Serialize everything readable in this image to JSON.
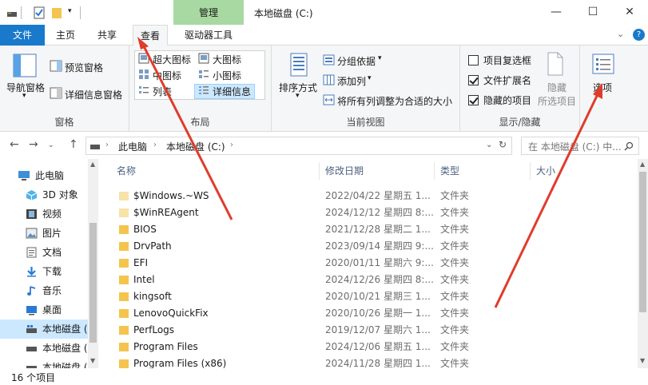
{
  "titlebar": {
    "context_tab": "管理",
    "window_title": "本地磁盘 (C:)",
    "minimize": "—",
    "maximize": "☐",
    "close": "✕"
  },
  "tabs": {
    "file": "文件",
    "home": "主页",
    "share": "共享",
    "view": "查看",
    "drive_tools": "驱动器工具"
  },
  "ribbon": {
    "pane_group": {
      "nav_pane": "导航窗格",
      "preview_pane": "预览窗格",
      "details_pane": "详细信息窗格",
      "label": "窗格"
    },
    "layout_group": {
      "extra_large": "超大图标",
      "large": "大图标",
      "medium": "中图标",
      "small": "小图标",
      "list": "列表",
      "details": "详细信息",
      "label": "布局"
    },
    "current_view_group": {
      "sort_by": "排序方式",
      "group_by": "分组依据",
      "add_columns": "添加列",
      "size_all_columns": "将所有列调整为合适的大小",
      "label": "当前视图"
    },
    "show_hide_group": {
      "item_checkboxes": "项目复选框",
      "file_extensions": "文件扩展名",
      "hidden_items": "隐藏的项目",
      "hide_selected_1": "隐藏",
      "hide_selected_2": "所选项目",
      "label": "显示/隐藏",
      "item_checkboxes_checked": false,
      "file_extensions_checked": true,
      "hidden_items_checked": true
    },
    "options": "选项"
  },
  "address": {
    "crumb_pc": "此电脑",
    "crumb_drive": "本地磁盘 (C:)",
    "search_placeholder": "在 本地磁盘 (C:) 中..."
  },
  "nav_pane": {
    "items": [
      {
        "label": "此电脑",
        "icon": "computer-icon"
      },
      {
        "label": "3D 对象",
        "icon": "cube-icon"
      },
      {
        "label": "视频",
        "icon": "video-icon"
      },
      {
        "label": "图片",
        "icon": "picture-icon"
      },
      {
        "label": "文档",
        "icon": "document-icon"
      },
      {
        "label": "下载",
        "icon": "download-icon"
      },
      {
        "label": "音乐",
        "icon": "music-icon"
      },
      {
        "label": "桌面",
        "icon": "desktop-icon"
      },
      {
        "label": "本地磁盘 (",
        "icon": "drive-icon"
      },
      {
        "label": "本地磁盘 (",
        "icon": "drive-icon"
      },
      {
        "label": "本地磁盘 (",
        "icon": "drive-icon"
      }
    ]
  },
  "columns": {
    "name": "名称",
    "modified": "修改日期",
    "type": "类型",
    "size": "大小"
  },
  "files": [
    {
      "name": "$Windows.~WS",
      "date": "2022/04/22 星期五 1...",
      "type": "文件夹",
      "hidden": true
    },
    {
      "name": "$WinREAgent",
      "date": "2024/12/12 星期四 8:...",
      "type": "文件夹",
      "hidden": true
    },
    {
      "name": "BIOS",
      "date": "2021/12/28 星期二 1...",
      "type": "文件夹",
      "hidden": false
    },
    {
      "name": "DrvPath",
      "date": "2023/09/14 星期四 9:...",
      "type": "文件夹",
      "hidden": false
    },
    {
      "name": "EFI",
      "date": "2020/01/11 星期六 9:...",
      "type": "文件夹",
      "hidden": false
    },
    {
      "name": "Intel",
      "date": "2024/12/26 星期四 8:...",
      "type": "文件夹",
      "hidden": false
    },
    {
      "name": "kingsoft",
      "date": "2020/10/21 星期三 1...",
      "type": "文件夹",
      "hidden": false
    },
    {
      "name": "LenovoQuickFix",
      "date": "2020/10/26 星期一 1...",
      "type": "文件夹",
      "hidden": false
    },
    {
      "name": "PerfLogs",
      "date": "2019/12/07 星期六 1...",
      "type": "文件夹",
      "hidden": false
    },
    {
      "name": "Program Files",
      "date": "2024/12/06 星期五 1...",
      "type": "文件夹",
      "hidden": false
    },
    {
      "name": "Program Files (x86)",
      "date": "2024/11/28 星期四 1...",
      "type": "文件夹",
      "hidden": false
    }
  ],
  "status": {
    "item_count": "16 个项目"
  },
  "colors": {
    "file_tab": "#1979ca",
    "context_tab": "#a8d9a2",
    "selection": "#cce8ff",
    "folder": "#f4c44e",
    "arrow": "#e03c2c"
  }
}
